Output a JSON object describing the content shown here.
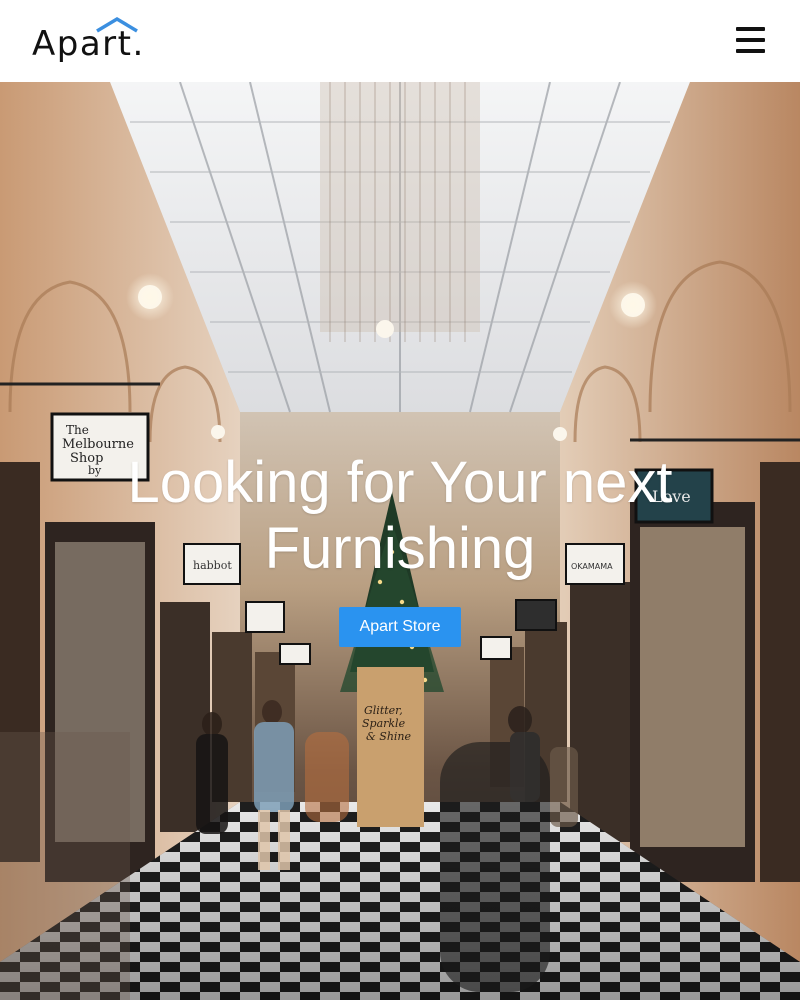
{
  "header": {
    "logo_text": "Apart.",
    "logo_icon": "roof-icon",
    "menu_icon": "hamburger-menu-icon"
  },
  "hero": {
    "title": "Looking for Your next Furnishing",
    "cta_label": "Apart Store",
    "signs": {
      "melbourne_shop": [
        "The",
        "Melbourne",
        "Shop",
        "by"
      ],
      "habbot": "habbot",
      "glitter": [
        "Glitter,",
        "Sparkle",
        "& Shine"
      ],
      "okamama": "OKAMAMA",
      "love": "Love"
    }
  },
  "colors": {
    "accent": "#2a93f0",
    "logo_roof": "#3b8fe0",
    "text_dark": "#111111",
    "hero_text": "#ffffff"
  }
}
